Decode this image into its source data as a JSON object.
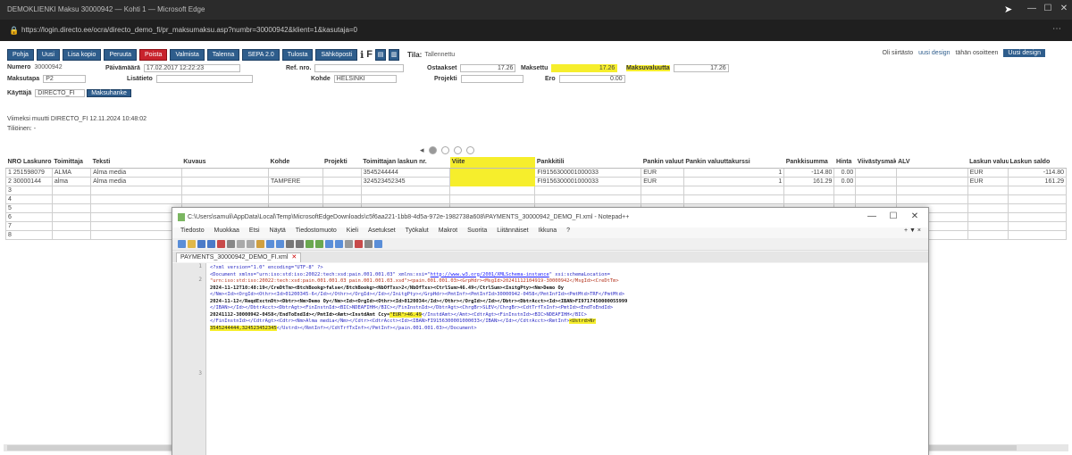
{
  "browser": {
    "title": "DEMOKLIENKI Maksu 30000942 — Kohti 1 — Microsoft Edge",
    "url": "https://login.directo.ee/ocra/directo_demo_fi/pr_maksumaksu.asp?numbr=30000942&klient=1&kasutaja=0"
  },
  "toolbar": {
    "buttons": [
      "Pohja",
      "Uusi",
      "Lisa kopio",
      "Peruuta",
      "Poista",
      "Valmista",
      "Talenna",
      "SEPA 2.0",
      "Tulosta",
      "Sähköposti"
    ],
    "small1": "▤",
    "small2": "▥",
    "label_tila": "Tila:",
    "tila_value": "Tallennettu",
    "right_text": "Oli siirtästo",
    "right_link": "uusi design",
    "right_text2": "tähän osoitteen",
    "right_button": "Uusi design"
  },
  "form": {
    "numero_label": "Numero",
    "numero_value": "30000942",
    "paivays_label": "Päivämäärä",
    "paivays_value": "17.02.2017 12:22:23",
    "ref_label": "Ref. nro.",
    "ref_value": "",
    "osoitteet_label": "Ostaakset",
    "osoitteet_value": "17.26",
    "maksettu_label": "Maksettu",
    "maksettu_value": "17.26",
    "maksuvaluutta_label": "Maksuvaluutta",
    "maksuvaluutta_value": "17.26",
    "maksutapa_label": "Maksutapa",
    "maksutapa_value": "P2",
    "lisatieto_label": "Lisätieto",
    "kohde_label": "Kohde",
    "kohde_value": "HELSINKI",
    "projekti_label": "Projekti",
    "ero_label": "Ero",
    "ero_value": "0.00",
    "kayttaja_label": "Käyttäjä",
    "kayttaja_value": "DIRECTO_FI",
    "kayttaja_button": "Maksuhanke"
  },
  "notes": {
    "line1": "Viimeksi muutti DIRECTO_FI 12.11.2024 10:48:02",
    "line2": "Tiliöinen: -"
  },
  "table": {
    "headers": [
      "NRO Laskunro.",
      "Toimittaja",
      "Teksti",
      "Kuvaus",
      "Kohde",
      "Projekti",
      "Toimittajan laskun nr.",
      "Viite",
      "Pankkitili",
      "Pankin valuutta",
      "Pankin valuuttakurssi",
      "Pankkisumma",
      "Hinta",
      "Viivästysmaksu",
      "ALV",
      "Laskun valuutta",
      "Laskun saldo"
    ],
    "rows": [
      {
        "nro": "1 251598079",
        "toimittaja": "ALMA",
        "teksti": "Alma media",
        "kuvaus": "",
        "kohde": "",
        "projekti": "",
        "laskun_nr": "3545244444",
        "viite": "",
        "pankkitili": "FI9156300001000033",
        "pankin_valuutta": "EUR",
        "kurssi": "1",
        "summa": "-114.80",
        "hinta": "0.00",
        "viivastys": "",
        "alv": "",
        "laskun_valuutta": "EUR",
        "saldo": "-114.80"
      },
      {
        "nro": "2 30000144",
        "toimittaja": "alma",
        "teksti": "Alma media",
        "kuvaus": "",
        "kohde": "TAMPERE",
        "projekti": "",
        "laskun_nr": "324523452345",
        "viite": "",
        "pankkitili": "FI9156300001000033",
        "pankin_valuutta": "EUR",
        "kurssi": "1",
        "summa": "161.29",
        "hinta": "0.00",
        "viivastys": "",
        "alv": "",
        "laskun_valuutta": "EUR",
        "saldo": "161.29"
      }
    ],
    "empty_row_numbers": [
      "3",
      "4",
      "5",
      "6",
      "7",
      "8"
    ]
  },
  "notepad": {
    "title": "C:\\Users\\samuli\\AppData\\Local\\Temp\\MicrosoftEdgeDownloads\\c5f6aa221-1bb8-4d5a-972e-1982738a608\\PAYMENTS_30000942_DEMO_FI.xml - Notepad++",
    "menu": [
      "Tiedosto",
      "Muokkaa",
      "Etsi",
      "Näytä",
      "Tiedostomuoto",
      "Kieli",
      "Asetukset",
      "Työkalut",
      "Makrot",
      "Suorita",
      "Liitännäiset",
      "Ikkuna",
      "?"
    ],
    "menu_right": "+ ▼ ×",
    "tab": "PAYMENTS_30000942_DEMO_FI.xml",
    "gutter": [
      "1",
      "",
      "2",
      "",
      "",
      "",
      "",
      "",
      "",
      "",
      "",
      "",
      "",
      "",
      "",
      "",
      "3"
    ],
    "code": {
      "l1_a": "<?xml version=\"1.0\" encoding=\"UTF-8\" ?>",
      "l2_a": "<Document xmlns=\"urn:iso:std:iso:20022:tech:xsd:pain.001.001.03\" xmlns:xsi=\"",
      "l2_url": "http://www.w3.org/2001/XMLSchema-instance",
      "l2_b": "\" xsi:schemaLocation=",
      "l3": "\"urn:iso:std:iso:20022:tech:xsd:pain.001.001.03 pain.001.001.03.xsd\"><pain.001.001.03><GrpHdr><MsgId>20241112104919-30000942</MsgId><CreDtTm>",
      "l4": "2024-11-12T10:48:19</CreDtTm><BtchBookg>false</BtchBookg><NbOfTxs>2</NbOfTxs><CtrlSum>46.49</CtrlSum><InitgPty><Nm>Demo Oy",
      "l5": "</Nm><Id><OrgId><Othr><Id>01200345-6</Id></Othr></OrgId></Id></InitgPty></GrpHdr><PmtInf><PmtInfId>30000942-0458</PmtInfId><PmtMtd>TRF</PmtMtd>",
      "l6": "2024-11-12</ReqdExctnDt><Dbtr><Nm>Demo Oy</Nm><Id><OrgId><Othr><Id>0120034</Id></Othr></OrgId></Id></Dbtr><DbtrAcct><Id><IBAN>FI9717450000055999",
      "l7": "</IBAN></Id></DbtrAcct><DbtrAgt><FinInstnId><BIC>NDEAFIHH</BIC></FinInstnId></DbtrAgt><ChrgBr>SLEV</ChrgBr><CdtTrfTxInf><PmtId><EndToEndId>",
      "l8_a": "20241112-30000942-0458</EndToEndId></PmtId><Amt><InstdAmt Ccy=",
      "l8_hl": "\"EUR\">46.49",
      "l8_b": "</InstdAmt></Amt><CdtrAgt><FinInstnId><BIC>NDEAFIHH</BIC>",
      "l9_a": "</FinInstnId></CdtrAgt><Cdtr><Nm>Alma media</Nm></Cdtr><CdtrAcct><Id><IBAN>FI9156300001000033</IBAN></Id></CdtrAcct><RmtInf>",
      "l9_hl": "<Ustrd>Nr",
      "l10_hl": "3545244444,324523452345",
      "l10_b": "</Ustrd></RmtInf></CdtTrfTxInf></PmtInf></pain.001.001.03></Document>"
    }
  }
}
